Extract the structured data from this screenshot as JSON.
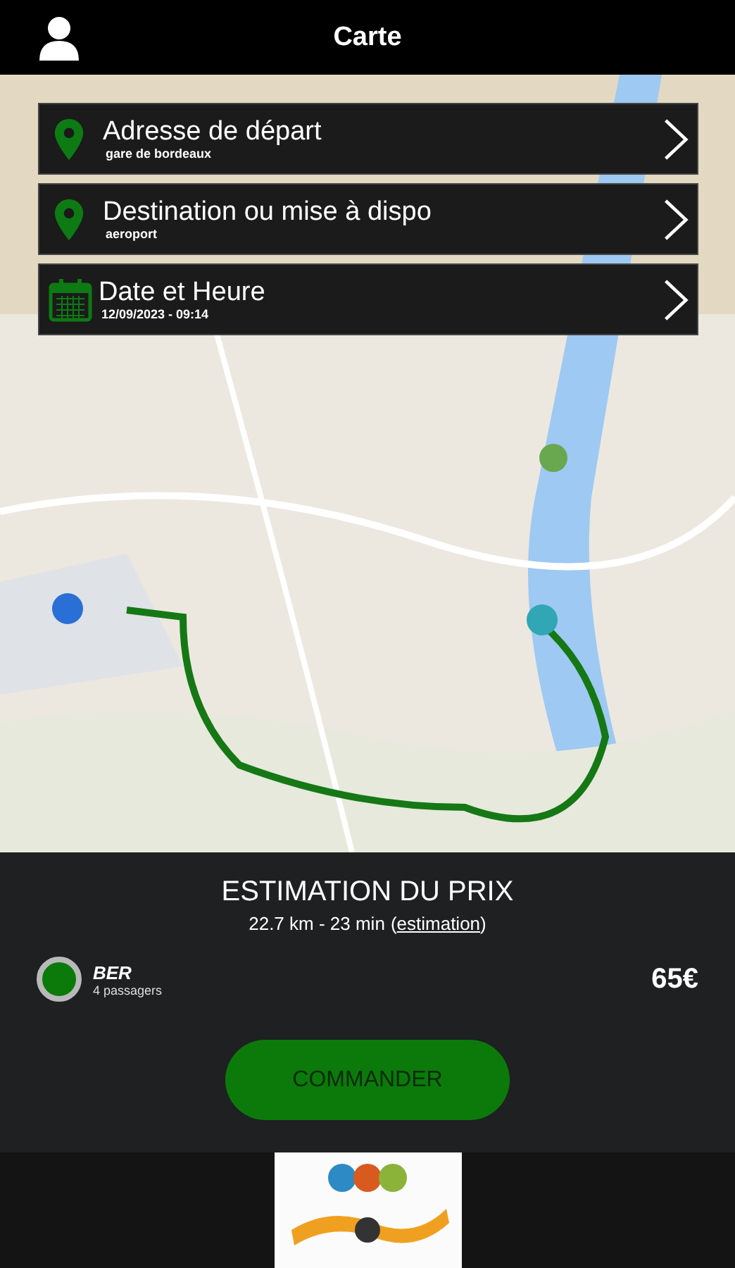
{
  "header": {
    "title": "Carte"
  },
  "trip_fields": [
    {
      "kind": "pin",
      "label": "Adresse de départ",
      "value": "gare de bordeaux"
    },
    {
      "kind": "pin",
      "label": "Destination ou mise à dispo",
      "value": "aeroport"
    },
    {
      "kind": "calendar",
      "label": "Date et Heure",
      "value": "12/09/2023 - 09:14"
    }
  ],
  "estimate": {
    "title": "ESTIMATION DU PRIX",
    "summary": "22.7 km - 23 min",
    "link_open": "(",
    "link": "estimation",
    "link_close": ")",
    "vehicles": [
      {
        "name": "BER",
        "capacity": "4 passagers",
        "price": "65€",
        "selected": true
      }
    ],
    "order_button": "COMMANDER"
  }
}
